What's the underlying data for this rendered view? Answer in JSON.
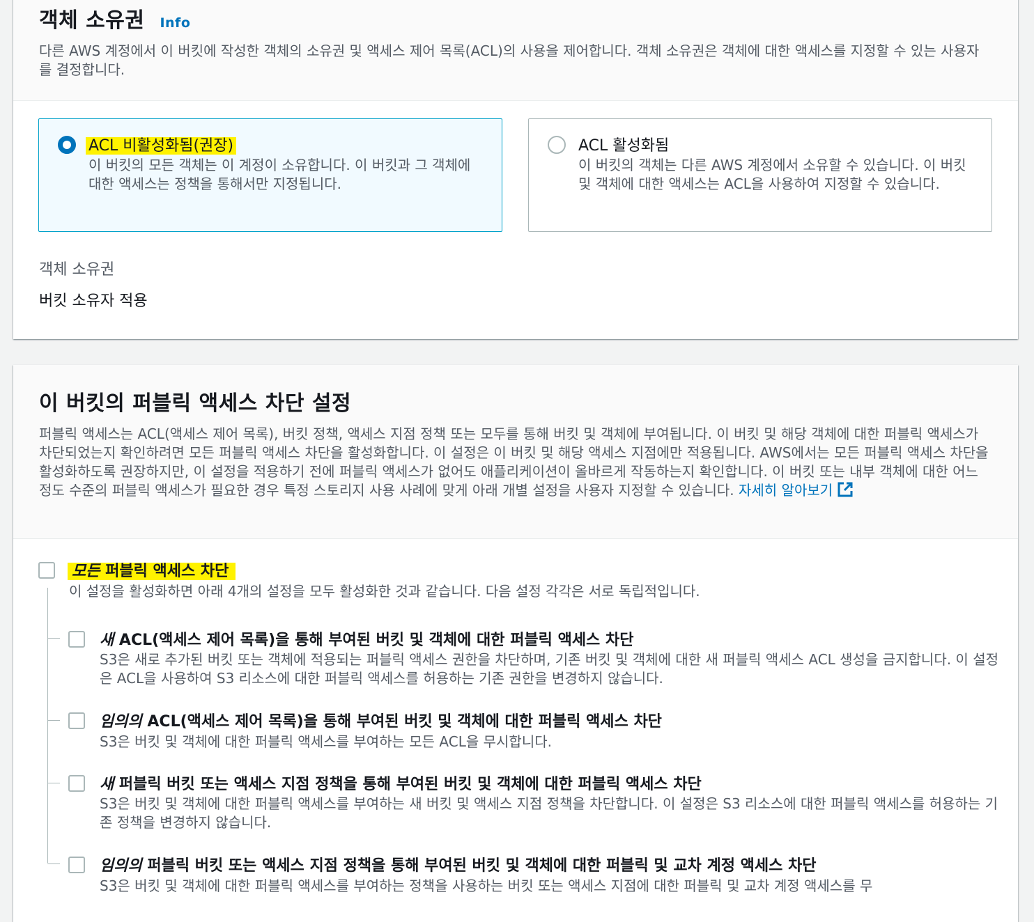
{
  "ownership": {
    "title": "객체 소유권",
    "info": "Info",
    "description": "다른 AWS 계정에서 이 버킷에 작성한 객체의 소유권 및 액세스 제어 목록(ACL)의 사용을 제어합니다. 객체 소유권은 객체에 대한 액세스를 지정할 수 있는 사용자를 결정합니다.",
    "options": [
      {
        "label": "ACL 비활성화됨(권장)",
        "description": "이 버킷의 모든 객체는 이 계정이 소유합니다. 이 버킷과 그 객체에 대한 액세스는 정책을 통해서만 지정됩니다.",
        "selected": true
      },
      {
        "label": "ACL 활성화됨",
        "description": "이 버킷의 객체는 다른 AWS 계정에서 소유할 수 있습니다. 이 버킷 및 객체에 대한 액세스는 ACL을 사용하여 지정할 수 있습니다.",
        "selected": false
      }
    ],
    "key": "객체 소유권",
    "value": "버킷 소유자 적용"
  },
  "public_access": {
    "title": "이 버킷의 퍼블릭 액세스 차단 설정",
    "description": "퍼블릭 액세스는 ACL(액세스 제어 목록), 버킷 정책, 액세스 지점 정책 또는 모두를 통해 버킷 및 객체에 부여됩니다. 이 버킷 및 해당 객체에 대한 퍼블릭 액세스가 차단되었는지 확인하려면 모든 퍼블릭 액세스 차단을 활성화합니다. 이 설정은 이 버킷 및 해당 액세스 지점에만 적용됩니다. AWS에서는 모든 퍼블릭 액세스 차단을 활성화하도록 권장하지만, 이 설정을 적용하기 전에 퍼블릭 액세스가 없어도 애플리케이션이 올바르게 작동하는지 확인합니다. 이 버킷 또는 내부 객체에 대한 어느 정도 수준의 퍼블릭 액세스가 필요한 경우 특정 스토리지 사용 사례에 맞게 아래 개별 설정을 사용자 지정할 수 있습니다.",
    "learn_more": "자세히 알아보기",
    "block_all": {
      "emphasis": "모든",
      "label": "퍼블릭 액세스 차단",
      "description": "이 설정을 활성화하면 아래 4개의 설정을 모두 활성화한 것과 같습니다. 다음 설정 각각은 서로 독립적입니다.",
      "checked": false
    },
    "options": [
      {
        "emphasis": "새",
        "label": "ACL(액세스 제어 목록)을 통해 부여된 버킷 및 객체에 대한 퍼블릭 액세스 차단",
        "description": "S3은 새로 추가된 버킷 또는 객체에 적용되는 퍼블릭 액세스 권한을 차단하며, 기존 버킷 및 객체에 대한 새 퍼블릭 액세스 ACL 생성을 금지합니다. 이 설정은 ACL을 사용하여 S3 리소스에 대한 퍼블릭 액세스를 허용하는 기존 권한을 변경하지 않습니다.",
        "checked": false
      },
      {
        "emphasis": "임의의",
        "label": "ACL(액세스 제어 목록)을 통해 부여된 버킷 및 객체에 대한 퍼블릭 액세스 차단",
        "description": "S3은 버킷 및 객체에 대한 퍼블릭 액세스를 부여하는 모든 ACL을 무시합니다.",
        "checked": false
      },
      {
        "emphasis": "새",
        "label": "퍼블릭 버킷 또는 액세스 지점 정책을 통해 부여된 버킷 및 객체에 대한 퍼블릭 액세스 차단",
        "description": "S3은 버킷 및 객체에 대한 퍼블릭 액세스를 부여하는 새 버킷 및 액세스 지점 정책을 차단합니다. 이 설정은 S3 리소스에 대한 퍼블릭 액세스를 허용하는 기존 정책을 변경하지 않습니다.",
        "checked": false
      },
      {
        "emphasis": "임의의",
        "label": "퍼블릭 버킷 또는 액세스 지점 정책을 통해 부여된 버킷 및 객체에 대한 퍼블릭 및 교차 계정 액세스 차단",
        "description": "S3은 버킷 및 객체에 대한 퍼블릭 액세스를 부여하는 정책을 사용하는 버킷 또는 액세스 지점에 대한 퍼블릭 및 교차 계정 액세스를 무",
        "checked": false
      }
    ]
  },
  "colors": {
    "link": "#0073bb",
    "highlight": "#fff200",
    "selected_border": "#00a1c9",
    "selected_bg": "#f1faff"
  }
}
